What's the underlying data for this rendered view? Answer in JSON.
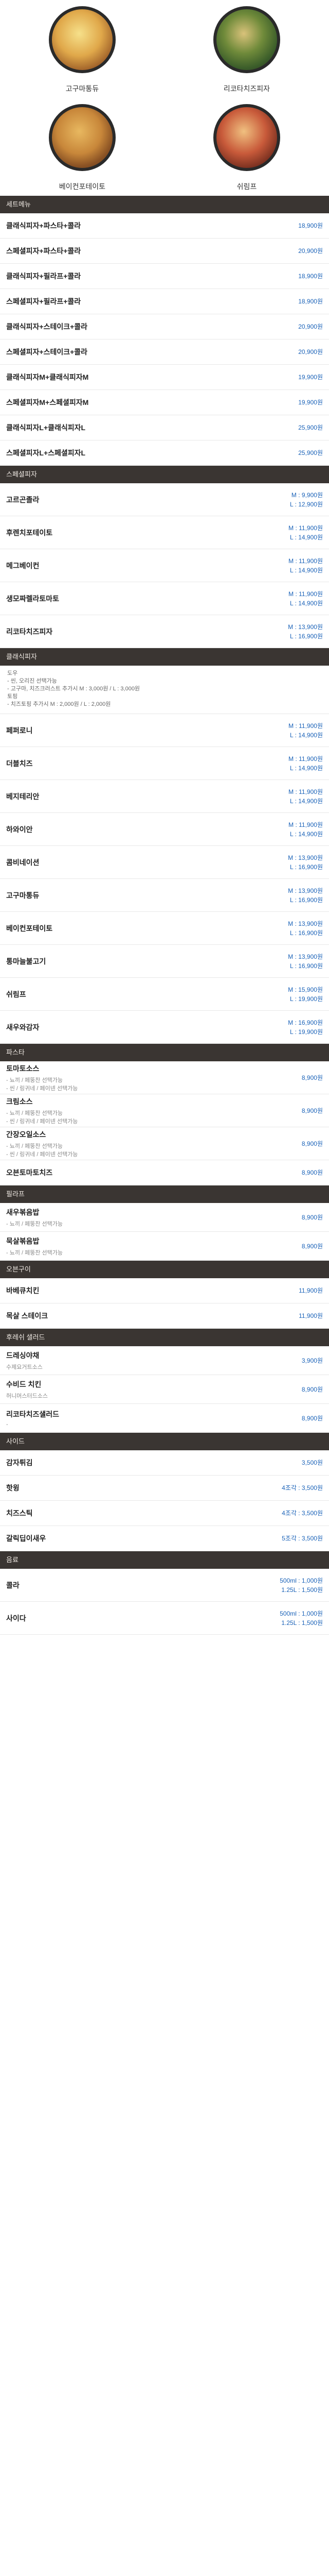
{
  "pizzas": [
    {
      "name": "고구마통듀"
    },
    {
      "name": "리코타치즈피자"
    },
    {
      "name": "베이컨포테이토"
    },
    {
      "name": "쉬림프"
    }
  ],
  "sections": {
    "set": {
      "title": "세트메뉴",
      "items": [
        {
          "name": "클래식피자+파스타+콜라",
          "price": "18,900원"
        },
        {
          "name": "스페셜피자+파스타+콜라",
          "price": "20,900원"
        },
        {
          "name": "클래식피자+필라프+콜라",
          "price": "18,900원"
        },
        {
          "name": "스페셜피자+필라프+콜라",
          "price": "18,900원"
        },
        {
          "name": "클래식피자+스테이크+콜라",
          "price": "20,900원"
        },
        {
          "name": "스페셜피자+스테이크+콜라",
          "price": "20,900원"
        },
        {
          "name": "클래식피자M+클래식피자M",
          "price": "19,900원"
        },
        {
          "name": "스페셜피자M+스페셜피자M",
          "price": "19,900원"
        },
        {
          "name": "클래식피자L+클래식피자L",
          "price": "25,900원"
        },
        {
          "name": "스페셜피자L+스페셜피자L",
          "price": "25,900원"
        }
      ]
    },
    "special": {
      "title": "스페셜피자",
      "items": [
        {
          "name": "고르곤졸라",
          "m": "M : 9,900원",
          "l": "L : 12,900원"
        },
        {
          "name": "후렌치포테이토",
          "m": "M : 11,900원",
          "l": "L : 14,900원"
        },
        {
          "name": "메그베이컨",
          "m": "M : 11,900원",
          "l": "L : 14,900원"
        },
        {
          "name": "생모짜렐라토마토",
          "m": "M : 11,900원",
          "l": "L : 14,900원"
        },
        {
          "name": "리코타치즈피자",
          "m": "M : 13,900원",
          "l": "L : 16,900원"
        }
      ]
    },
    "classic": {
      "title": "클래식피자",
      "notes": [
        "도우",
        "- 씬, 오리진 선택가능",
        "- 고구마, 치즈크러스트 추가시 M : 3,000원 / L : 3,000원",
        "토핑",
        "- 치즈토핑 추가시 M : 2,000원 / L : 2,000원"
      ],
      "items": [
        {
          "name": "페퍼로니",
          "m": "M : 11,900원",
          "l": "L : 14,900원"
        },
        {
          "name": "더블치즈",
          "m": "M : 11,900원",
          "l": "L : 14,900원"
        },
        {
          "name": "베지테리안",
          "m": "M : 11,900원",
          "l": "L : 14,900원"
        },
        {
          "name": "하와이안",
          "m": "M : 11,900원",
          "l": "L : 14,900원"
        },
        {
          "name": "콤비네이션",
          "m": "M : 13,900원",
          "l": "L : 16,900원"
        },
        {
          "name": "고구마통듀",
          "m": "M : 13,900원",
          "l": "L : 16,900원"
        },
        {
          "name": "베이컨포테이토",
          "m": "M : 13,900원",
          "l": "L : 16,900원"
        },
        {
          "name": "통마늘불고기",
          "m": "M : 13,900원",
          "l": "L : 16,900원"
        },
        {
          "name": "쉬림프",
          "m": "M : 15,900원",
          "l": "L : 19,900원"
        },
        {
          "name": "새우와감자",
          "m": "M : 16,900원",
          "l": "L : 19,900원"
        }
      ]
    },
    "pasta": {
      "title": "파스타",
      "items": [
        {
          "name": "토마토소스",
          "sub": "- 뇨끼 / 페뚱찬 선택가능\n- 씬 / 링귀네 / 페이넨 선택가능",
          "price": "8,900원"
        },
        {
          "name": "크림소스",
          "sub": "- 뇨끼 / 페뚱찬 선택가능\n- 씬 / 링귀네 / 페이넨 선택가능",
          "price": "8,900원"
        },
        {
          "name": "간장오일소스",
          "sub": "- 뇨끼 / 페뚱찬 선택가능\n- 씬 / 링귀네 / 페이넨 선택가능",
          "price": "8,900원"
        },
        {
          "name": "오븐토마토치즈",
          "sub": "",
          "price": "8,900원"
        }
      ]
    },
    "pilaf": {
      "title": "필라프",
      "items": [
        {
          "name": "새우볶음밥",
          "sub": "- 뇨끼 / 페뚱찬 선택가능",
          "price": "8,900원"
        },
        {
          "name": "묵살볶음밥",
          "sub": "- 뇨끼 / 페뚱찬 선택가능",
          "price": "8,900원"
        }
      ]
    },
    "oven": {
      "title": "오븐구이",
      "items": [
        {
          "name": "바베큐치킨",
          "sub": "",
          "price": "11,900원"
        },
        {
          "name": "목살 스테이크",
          "sub": "",
          "price": "11,900원"
        }
      ]
    },
    "salad": {
      "title": "후레쉬 샐러드",
      "items": [
        {
          "name": "드레싱야채",
          "sub": "수제요거트소스",
          "price": "3,900원"
        },
        {
          "name": "수비드 치킨",
          "sub": "허니머스터드소스",
          "price": "8,900원"
        },
        {
          "name": "리코타치즈샐러드",
          "sub": "-",
          "price": "8,900원"
        }
      ]
    },
    "side": {
      "title": "사이드",
      "items": [
        {
          "name": "감자튀김",
          "price": "3,500원"
        },
        {
          "name": "핫윙",
          "price": "4조각 : 3,500원"
        },
        {
          "name": "치즈스틱",
          "price": "4조각 : 3,500원"
        },
        {
          "name": "갈릭딥이새우",
          "price": "5조각 : 3,500원"
        }
      ]
    },
    "drink": {
      "title": "음료",
      "items": [
        {
          "name": "콜라",
          "m": "500ml : 1,000원",
          "l": "1.25L : 1,500원"
        },
        {
          "name": "사이다",
          "m": "500ml : 1,000원",
          "l": "1.25L : 1,500원"
        }
      ]
    }
  }
}
